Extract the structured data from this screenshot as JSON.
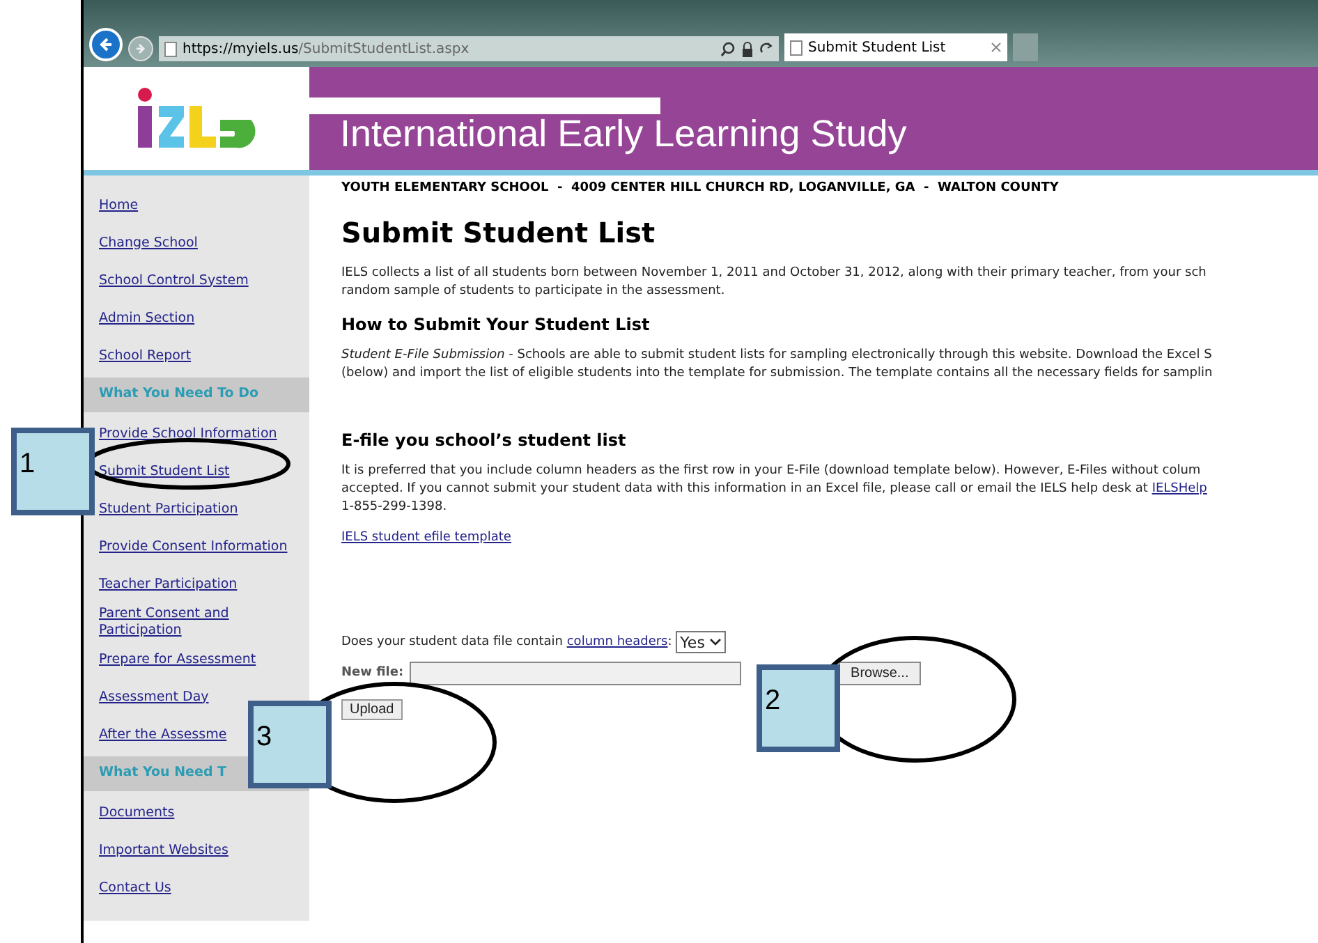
{
  "browser": {
    "address_host": "https://myiels.us",
    "address_path": "/SubmitStudentList.aspx",
    "tab_title": "Submit Student List"
  },
  "header": {
    "title": "International Early Learning Study"
  },
  "sidebar": {
    "items": [
      {
        "kind": "link",
        "label": "Home"
      },
      {
        "kind": "link",
        "label": "Change School"
      },
      {
        "kind": "link",
        "label": "School Control System"
      },
      {
        "kind": "link",
        "label": "Admin Section"
      },
      {
        "kind": "link",
        "label": "School Report"
      },
      {
        "kind": "heading",
        "label": "What You Need To Do"
      },
      {
        "kind": "link",
        "label": "Provide School Information"
      },
      {
        "kind": "link",
        "label": "Submit Student List"
      },
      {
        "kind": "link",
        "label": "Student Participation"
      },
      {
        "kind": "link",
        "label": "Provide Consent Information"
      },
      {
        "kind": "link",
        "label": "Teacher Participation"
      },
      {
        "kind": "link",
        "label": "Parent Consent and Participation"
      },
      {
        "kind": "link",
        "label": "Prepare for Assessment"
      },
      {
        "kind": "link",
        "label": "Assessment Day"
      },
      {
        "kind": "link",
        "label": "After the Assessme"
      },
      {
        "kind": "heading",
        "label": "What You Need T"
      },
      {
        "kind": "link",
        "label": "Documents"
      },
      {
        "kind": "link",
        "label": "Important Websites"
      },
      {
        "kind": "link",
        "label": "Contact Us"
      }
    ]
  },
  "school_line": "YOUTH ELEMENTARY SCHOOL  -  4009 CENTER HILL CHURCH RD, LOGANVILLE, GA  -  WALTON COUNTY",
  "page_title": "Submit Student List",
  "intro_lines": [
    "IELS collects a list of all students born between November 1, 2011 and October 31, 2012, along with their primary teacher, from your sch",
    "random sample of students to participate in the assessment."
  ],
  "how_heading": "How to Submit Your Student List",
  "how_lines": [
    {
      "lead": "Student E-File Submission",
      "text": " - Schools are able to submit student lists for sampling electronically through this website. Download the Excel S"
    },
    {
      "text": "(below) and import the list of eligible students into the template for submission. The template contains all the necessary fields for samplin"
    }
  ],
  "efile_heading": "E-file you school’s student list",
  "efile_lines": [
    {
      "text": "It is preferred that you include column headers as the first row in your E-File (download template below). However, E-Files without colum"
    },
    {
      "text": "accepted. If you cannot submit your student data with this information in an Excel file, please call or email the IELS help desk at ",
      "link": "IELSHelp"
    },
    {
      "text": "1-855-299-1398."
    }
  ],
  "template_link": "IELS student efile template",
  "question": {
    "before": "Does your student data file contain ",
    "link": "column headers",
    "after": ":",
    "select_value": "Yes"
  },
  "file": {
    "label": "New file:",
    "browse": "Browse..."
  },
  "upload": "Upload",
  "callouts": [
    {
      "number": "1"
    },
    {
      "number": "2"
    },
    {
      "number": "3"
    }
  ]
}
